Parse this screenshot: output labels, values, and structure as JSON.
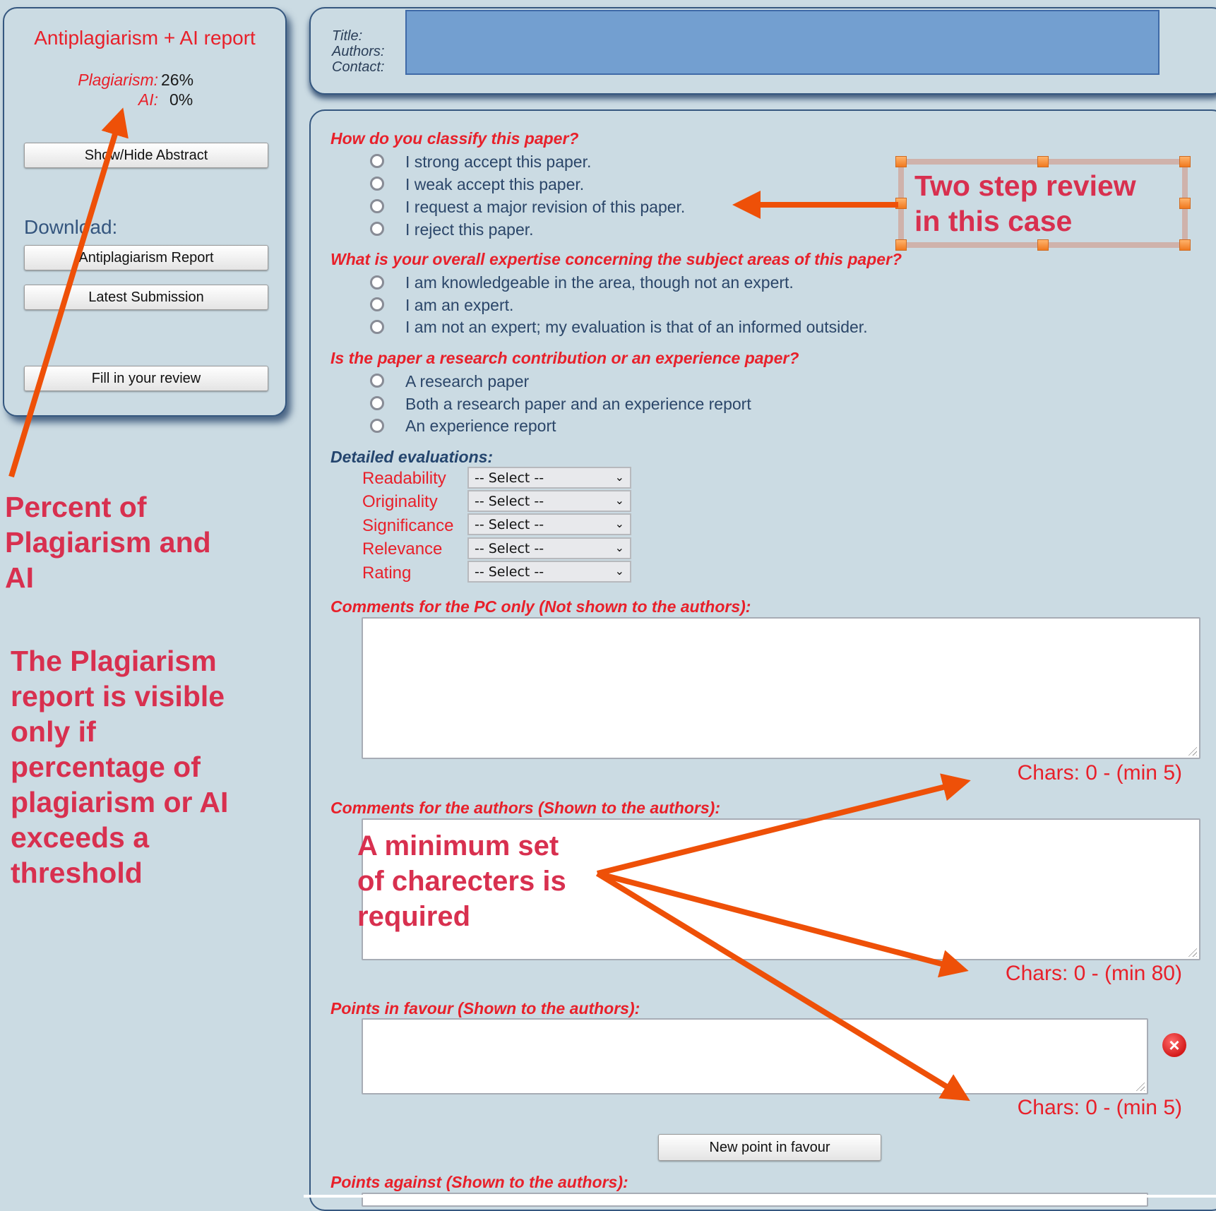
{
  "report": {
    "title": "Antiplagiarism + AI report",
    "plagiarism_label": "Plagiarism:",
    "plagiarism_value": "26%",
    "ai_label": "AI:",
    "ai_value": "0%"
  },
  "left_panel": {
    "show_hide_abstract": "Show/Hide Abstract",
    "download_label": "Download:",
    "antiplagiarism_report": "Antiplagiarism Report",
    "latest_submission": "Latest Submission",
    "fill_review": "Fill in your review"
  },
  "header": {
    "title_label": "Title:",
    "authors_label": "Authors:",
    "contact_label": "Contact:"
  },
  "form": {
    "classify": {
      "question": "How do you classify this paper?",
      "options": [
        "I strong accept this paper.",
        "I weak accept this paper.",
        "I request a major revision of this paper.",
        "I reject this paper."
      ]
    },
    "expertise": {
      "question": "What is your overall expertise concerning the subject areas of this paper?",
      "options": [
        "I am knowledgeable in the area, though not an expert.",
        "I am an expert.",
        "I am not an expert; my evaluation is that of an informed outsider."
      ]
    },
    "paper_type": {
      "question": "Is the paper a research contribution or an experience paper?",
      "options": [
        "A research paper",
        "Both a research paper and an experience report",
        "An experience report"
      ]
    },
    "detailed": {
      "heading": "Detailed evaluations:",
      "items": [
        {
          "label": "Readability",
          "value": "-- Select --"
        },
        {
          "label": "Originality",
          "value": "-- Select --"
        },
        {
          "label": "Significance",
          "value": "-- Select --"
        },
        {
          "label": "Relevance",
          "value": "-- Select --"
        },
        {
          "label": "Rating",
          "value": "-- Select --"
        }
      ]
    },
    "pc_comments": {
      "label": "Comments for the PC only (Not shown to the authors):",
      "value": "",
      "chars": "Chars: 0 - (min 5)"
    },
    "author_comments": {
      "label": "Comments for the authors (Shown to the authors):",
      "value": "",
      "chars": "Chars: 0 - (min 80)"
    },
    "points_favour": {
      "label": "Points in favour (Shown to the authors):",
      "value": "",
      "chars": "Chars: 0 - (min 5)",
      "new_button": "New point in favour"
    },
    "points_against": {
      "label": "Points against (Shown to the authors):"
    }
  },
  "annotations": {
    "two_step": [
      "Two step review",
      "in this case"
    ],
    "percent": [
      "Percent of",
      "Plagiarism and",
      "AI"
    ],
    "visibility": [
      "The Plagiarism",
      "report is visible",
      "only if",
      "percentage of",
      "plagiarism or AI",
      "exceeds a",
      "threshold"
    ],
    "min_chars": [
      "A minimum set",
      "of charecters is",
      "required"
    ]
  },
  "colors": {
    "background": "#cbdbe3",
    "panel_border": "#35577f",
    "label_red": "#e8202a",
    "annotation_red": "#d8304f",
    "arrow_orange": "#ee5008",
    "title_block": "#739fd0"
  }
}
